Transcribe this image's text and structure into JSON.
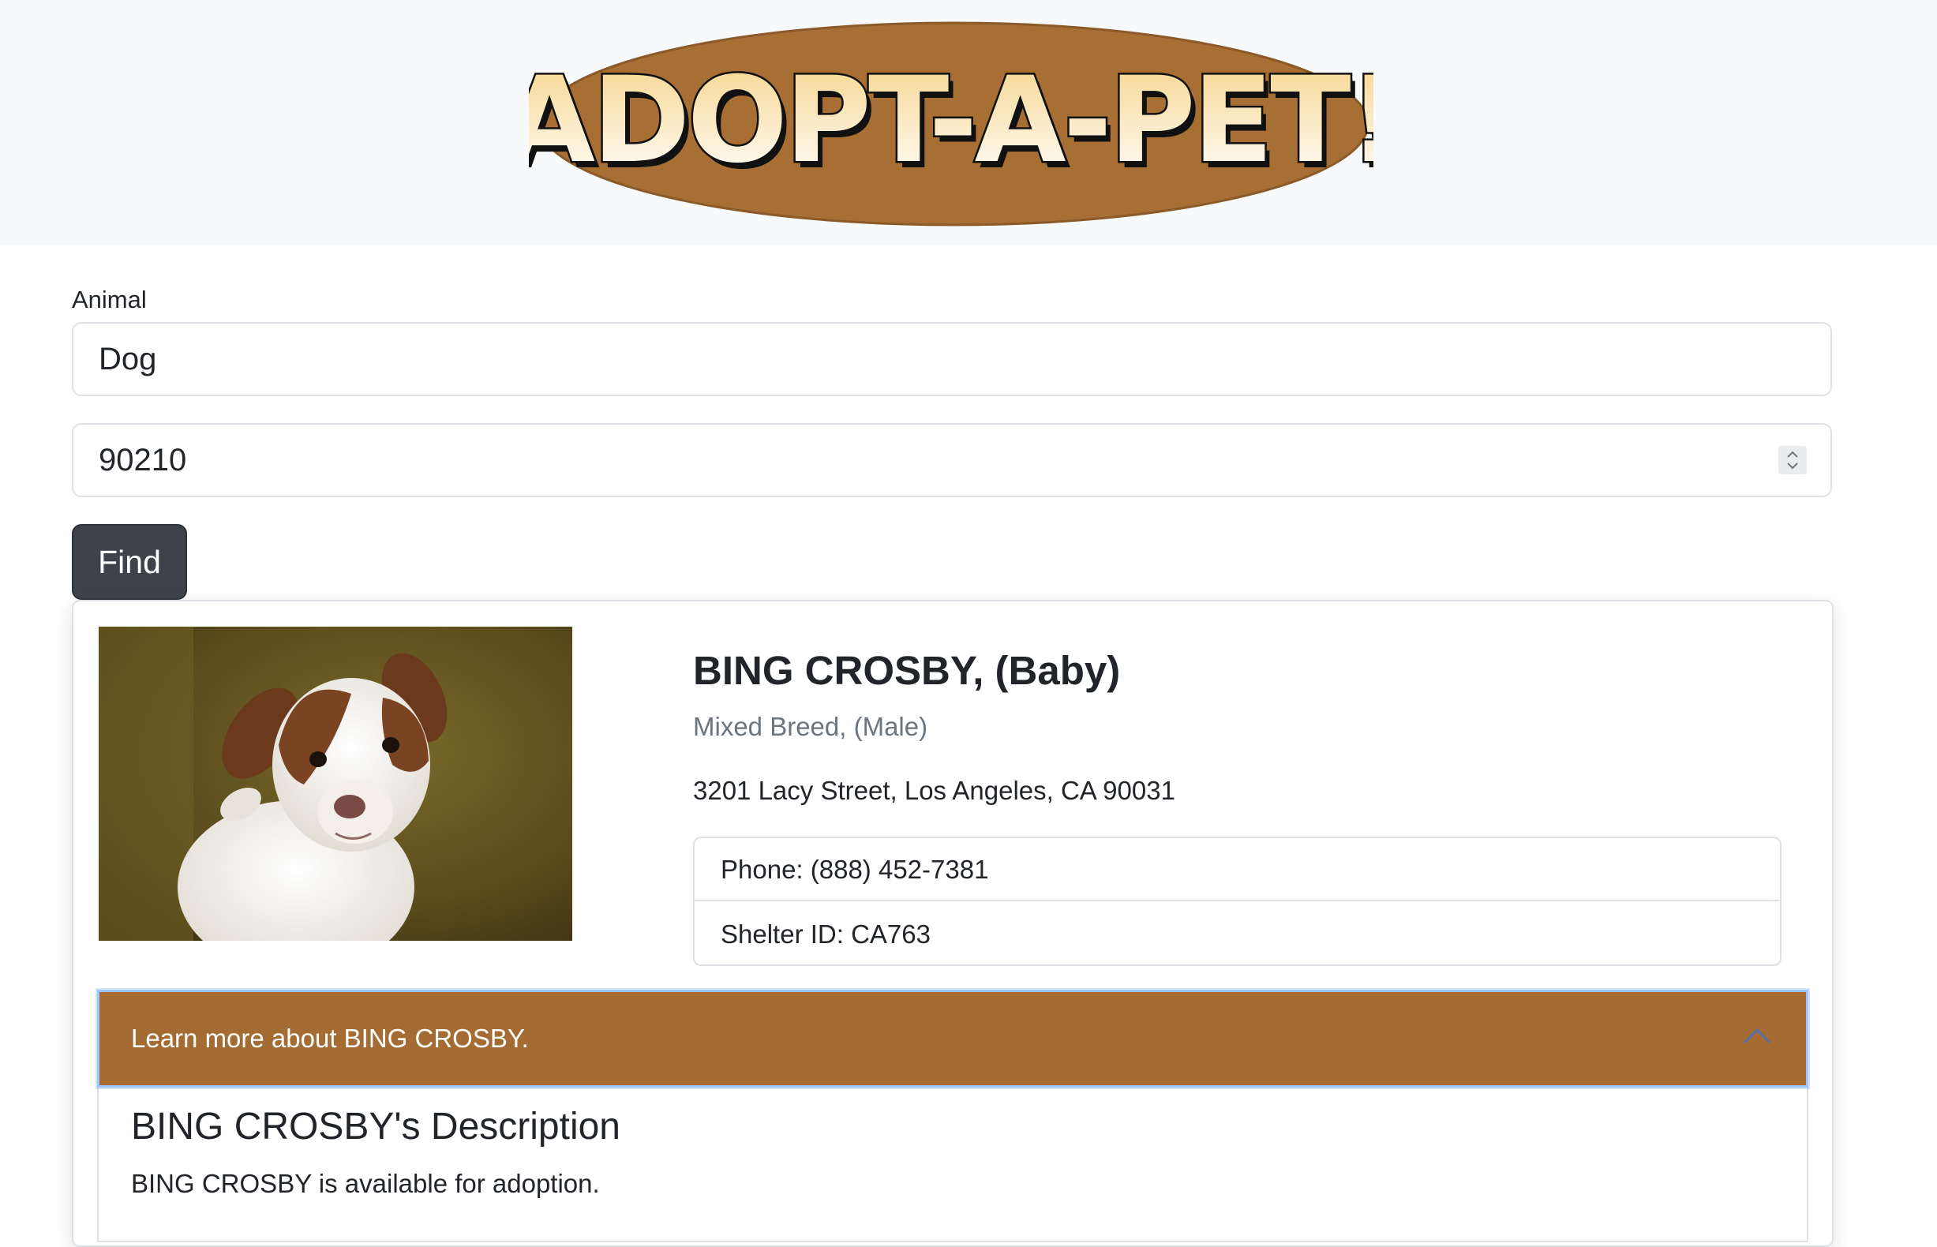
{
  "header": {
    "logo_text": "ADOPT-A-PET!"
  },
  "search": {
    "animal_label": "Animal",
    "animal_value": "Dog",
    "zip_value": "90210",
    "find_label": "Find"
  },
  "result": {
    "name": "BING CROSBY, (Baby)",
    "breed": "Mixed Breed, (Male)",
    "address": "3201 Lacy Street, Los Angeles, CA 90031",
    "phone": "Phone: (888) 452-7381",
    "shelter_id": "Shelter ID: CA763",
    "photo_icon": "dog-photo"
  },
  "accordion": {
    "title": "Learn more about BING CROSBY.",
    "expanded": true,
    "chevron_icon": "chevron-up-icon",
    "description_heading": "BING CROSBY's Description",
    "description_text": "BING CROSBY is available for adoption."
  },
  "colors": {
    "brand_brown": "#a46b32",
    "find_button": "#3d4349",
    "header_bg": "#f8f9fa"
  }
}
